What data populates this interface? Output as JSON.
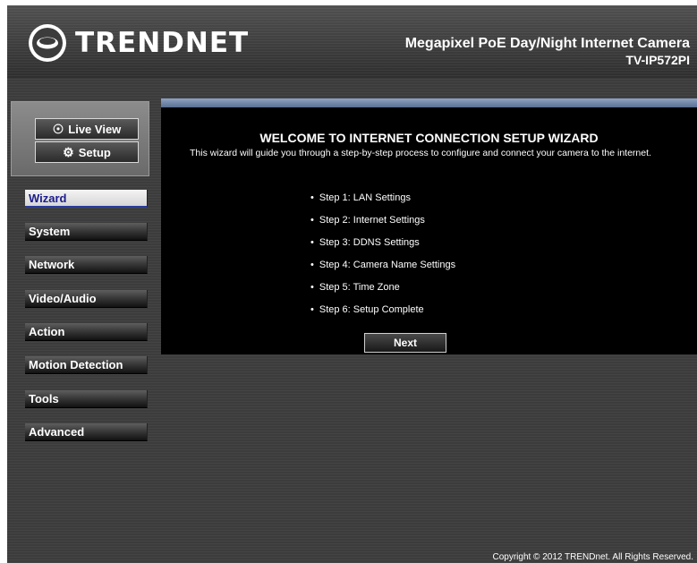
{
  "header": {
    "logo_text": "TRENDNET",
    "product_line1": "Megapixel PoE Day/Night Internet Camera",
    "product_line2": "TV-IP572PI"
  },
  "view_buttons": {
    "live_view": "Live View",
    "setup": "Setup"
  },
  "menu": {
    "items": [
      {
        "label": "Wizard",
        "active": true
      },
      {
        "label": "System"
      },
      {
        "label": "Network"
      },
      {
        "label": "Video/Audio"
      },
      {
        "label": "Action"
      },
      {
        "label": "Motion Detection"
      },
      {
        "label": "Tools"
      },
      {
        "label": "Advanced"
      }
    ]
  },
  "wizard": {
    "title": "WELCOME TO INTERNET CONNECTION SETUP WIZARD",
    "description": "This wizard will guide you through a step-by-step process to configure and connect your camera to the internet.",
    "steps": [
      "Step 1: LAN Settings",
      "Step 2: Internet Settings",
      "Step 3: DDNS Settings",
      "Step 4: Camera Name Settings",
      "Step 5: Time Zone",
      "Step 6: Setup Complete"
    ],
    "next_label": "Next"
  },
  "footer": {
    "copyright": "Copyright © 2012 TRENDnet. All Rights Reserved."
  },
  "colors": {
    "accent_bar": "#8fa4c4",
    "active_menu_text": "#1c1c8c"
  }
}
